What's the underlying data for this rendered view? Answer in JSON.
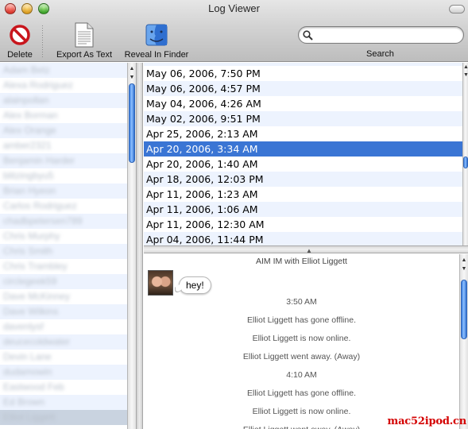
{
  "window": {
    "title": "Log Viewer"
  },
  "toolbar": {
    "delete_label": "Delete",
    "export_label": "Export As Text",
    "reveal_label": "Reveal In Finder",
    "search_label": "Search",
    "search_value": "",
    "search_placeholder": ""
  },
  "contacts": {
    "items": [
      "Adam Betz",
      "Alexa Rodriguez",
      "alainpollan",
      "Alex Borman",
      "Alex Orange",
      "amber2321",
      "Benjamin Harder",
      "blitzingbyu5",
      "Brian Hyeon",
      "Carlos Rodriguez",
      "chadbpetersen789",
      "Chris Murphy",
      "Chris Smith",
      "Chris Trambley",
      "circlegeek59",
      "Dave McKinney",
      "Dave Wilkins",
      "davenlysf",
      "deucecoldwater",
      "Devin Lane",
      "dudamowin",
      "Eastwood Feb",
      "Ed Brown",
      "Elliot Liggett"
    ]
  },
  "logs": {
    "dates": [
      "May 06, 2006, 7:50 PM",
      "May 06, 2006, 4:57 PM",
      "May 04, 2006, 4:26 AM",
      "May 02, 2006, 9:51 PM",
      "Apr 25, 2006, 2:13 AM",
      "Apr 20, 2006, 3:34 AM",
      "Apr 20, 2006, 1:40 AM",
      "Apr 18, 2006, 12:03 PM",
      "Apr 11, 2006, 1:23 AM",
      "Apr 11, 2006, 1:06 AM",
      "Apr 11, 2006, 12:30 AM",
      "Apr 04, 2006, 11:44 PM"
    ],
    "selected_index": 5
  },
  "transcript": {
    "header": "AIM IM with Elliot Liggett",
    "message": "hey!",
    "events": [
      "3:50 AM",
      "Elliot Liggett has gone offline.",
      "Elliot Liggett is now online.",
      "Elliot Liggett went away. (Away)",
      "4:10 AM",
      "Elliot Liggett has gone offline.",
      "Elliot Liggett is now online.",
      "Elliot Liggett went away. (Away)"
    ]
  },
  "watermark": "mac52ipod.cn",
  "colors": {
    "selection": "#3a75d4",
    "alt_row": "#edf3fe",
    "watermark": "#d40000"
  }
}
